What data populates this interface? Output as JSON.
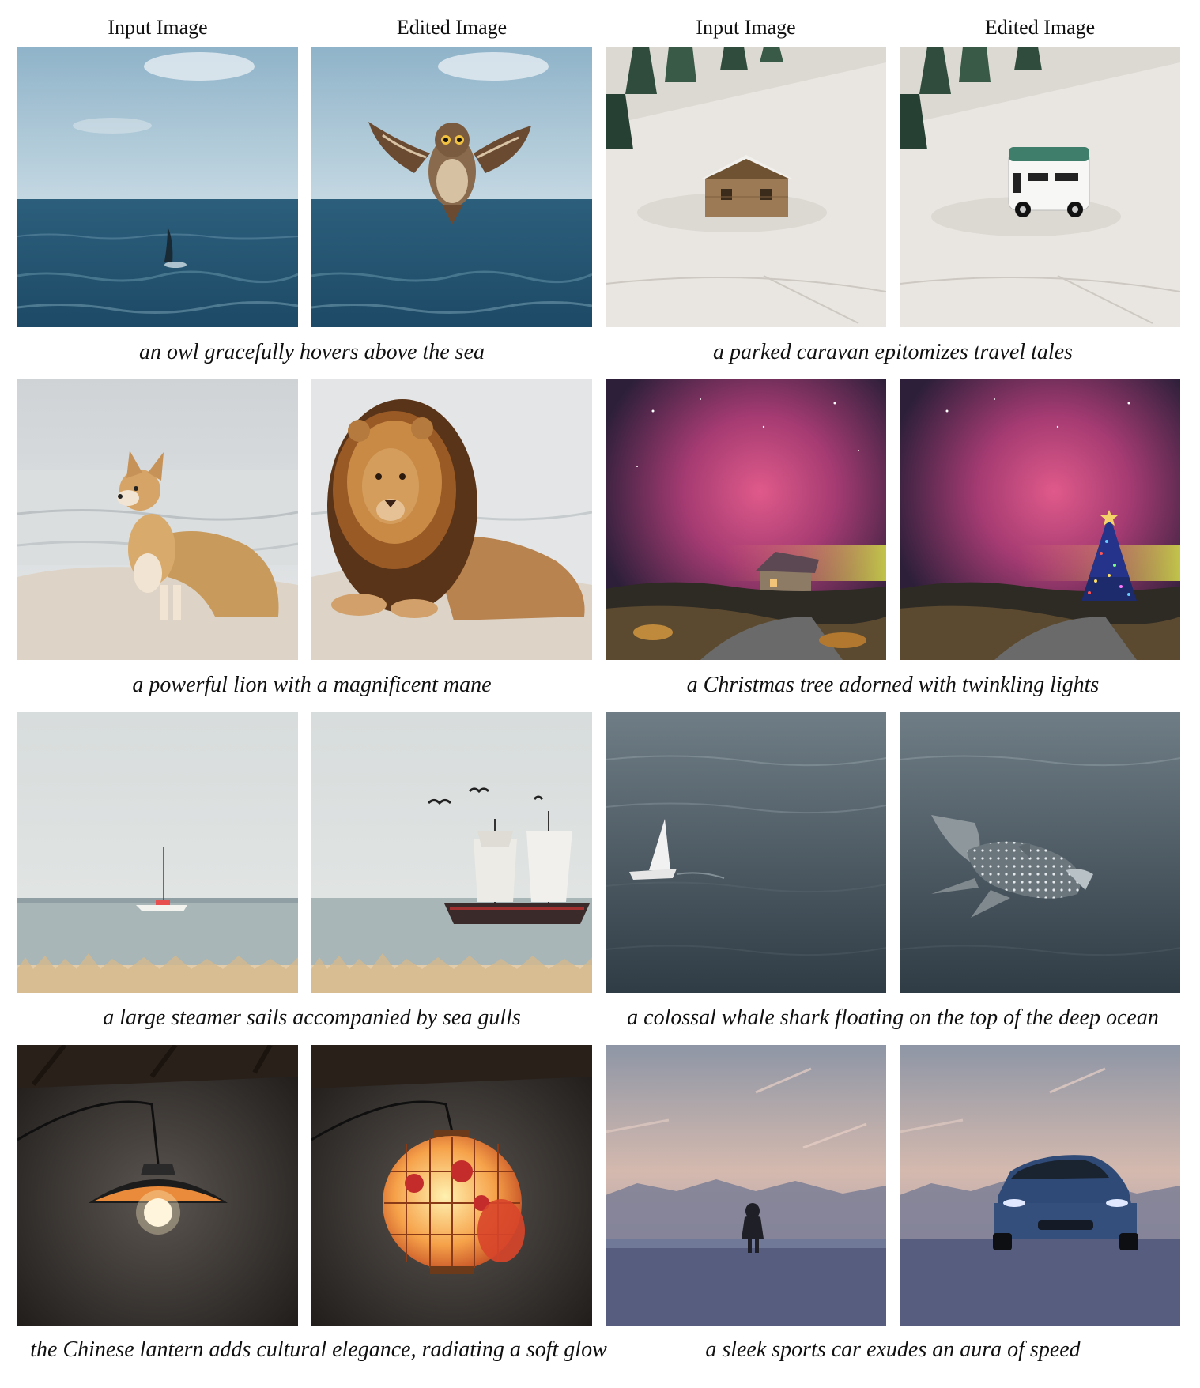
{
  "headers": [
    "Input Image",
    "Edited Image",
    "Input Image",
    "Edited Image"
  ],
  "captions": [
    "an owl gracefully hovers above the sea",
    "a parked caravan epitomizes travel tales",
    "a powerful lion with a magnificent mane",
    "a Christmas tree adorned with twinkling lights",
    "a large steamer sails accompanied by sea gulls",
    "a colossal whale shark floating on the top of the deep ocean",
    "the Chinese lantern adds cultural elegance, radiating a soft glow",
    "a sleek sports car exudes an aura of speed"
  ]
}
